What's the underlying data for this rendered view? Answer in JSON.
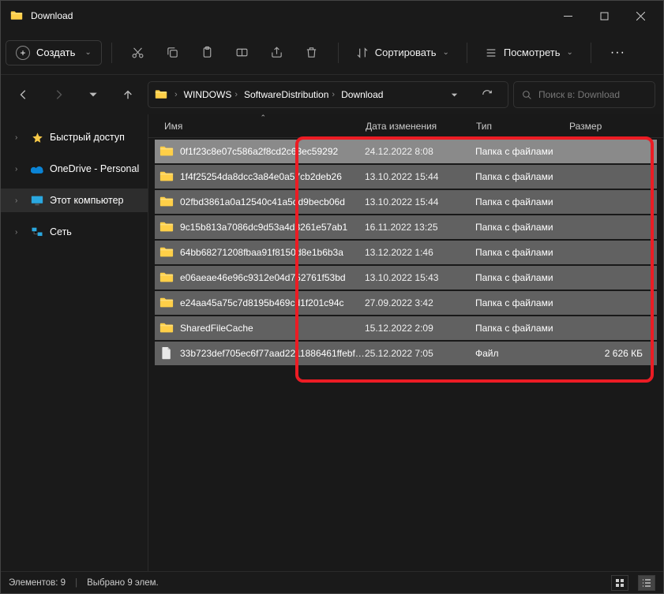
{
  "window": {
    "title": "Download"
  },
  "toolbar": {
    "new_label": "Создать",
    "sort_label": "Сортировать",
    "view_label": "Посмотреть"
  },
  "breadcrumbs": {
    "items": [
      "WINDOWS",
      "SoftwareDistribution",
      "Download"
    ]
  },
  "search": {
    "placeholder": "Поиск в: Download"
  },
  "sidebar": {
    "items": [
      {
        "label": "Быстрый доступ"
      },
      {
        "label": "OneDrive - Personal"
      },
      {
        "label": "Этот компьютер"
      },
      {
        "label": "Сеть"
      }
    ]
  },
  "columns": {
    "name": "Имя",
    "date": "Дата изменения",
    "type": "Тип",
    "size": "Размер"
  },
  "files": [
    {
      "name": "0f1f23c8e07c586a2f8cd2c63ec59292",
      "date": "24.12.2022 8:08",
      "type": "Папка с файлами",
      "size": "",
      "kind": "folder"
    },
    {
      "name": "1f4f25254da8dcc3a84e0a57cb2deb26",
      "date": "13.10.2022 15:44",
      "type": "Папка с файлами",
      "size": "",
      "kind": "folder"
    },
    {
      "name": "02fbd3861a0a12540c41a5dd9becb06d",
      "date": "13.10.2022 15:44",
      "type": "Папка с файлами",
      "size": "",
      "kind": "folder"
    },
    {
      "name": "9c15b813a7086dc9d53a4d8261e57ab1",
      "date": "16.11.2022 13:25",
      "type": "Папка с файлами",
      "size": "",
      "kind": "folder"
    },
    {
      "name": "64bb68271208fbaa91f8150d8e1b6b3a",
      "date": "13.12.2022 1:46",
      "type": "Папка с файлами",
      "size": "",
      "kind": "folder"
    },
    {
      "name": "e06aeae46e96c9312e04d752761f53bd",
      "date": "13.10.2022 15:43",
      "type": "Папка с файлами",
      "size": "",
      "kind": "folder"
    },
    {
      "name": "e24aa45a75c7d8195b469cd1f201c94c",
      "date": "27.09.2022 3:42",
      "type": "Папка с файлами",
      "size": "",
      "kind": "folder"
    },
    {
      "name": "SharedFileCache",
      "date": "15.12.2022 2:09",
      "type": "Папка с файлами",
      "size": "",
      "kind": "folder"
    },
    {
      "name": "33b723def705ec6f77aad2211886461ffebfe...",
      "date": "25.12.2022 7:05",
      "type": "Файл",
      "size": "2 626 КБ",
      "kind": "file"
    }
  ],
  "status": {
    "count_label": "Элементов: 9",
    "selected_label": "Выбрано 9 элем."
  }
}
